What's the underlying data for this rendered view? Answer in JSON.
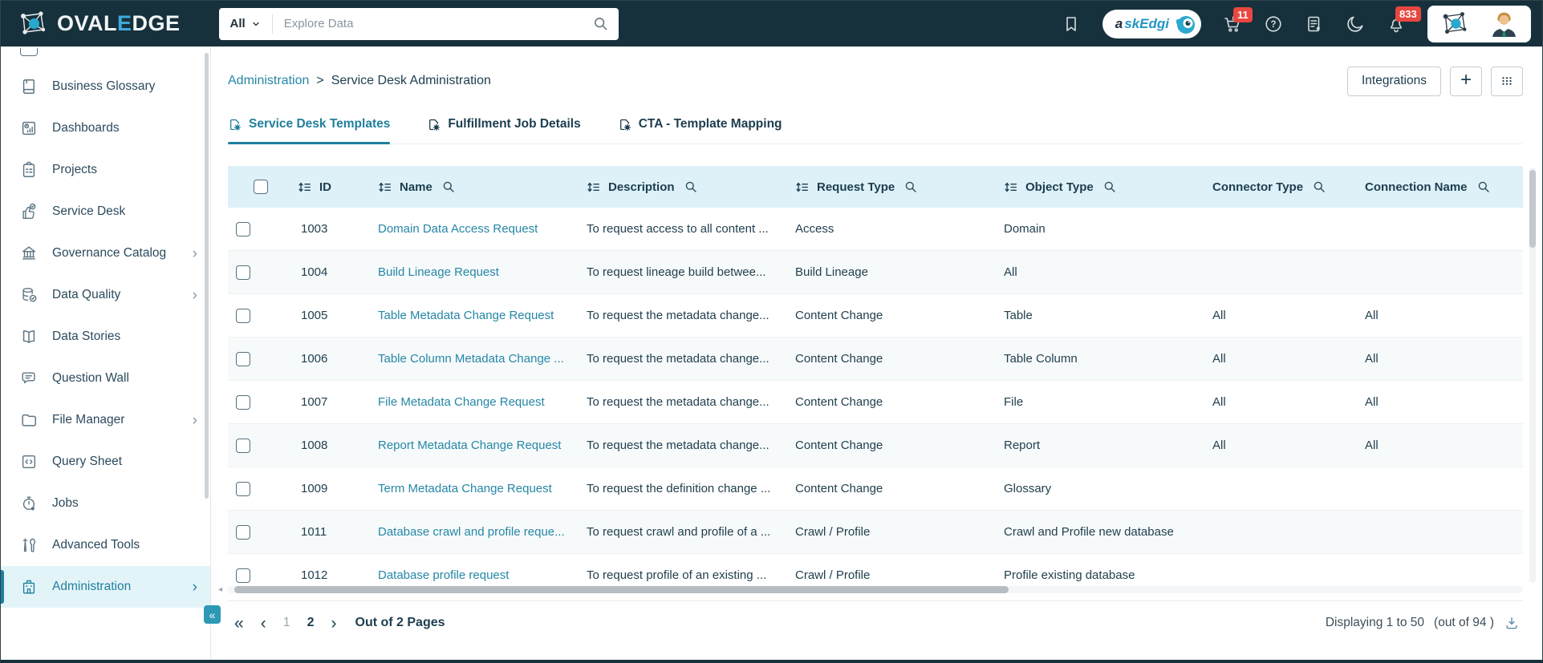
{
  "colors": {
    "accent": "#1F7F9D",
    "header_bg": "#17313C",
    "badge_red": "#E8473F",
    "table_header_bg": "#DEF1F8",
    "link_teal": "#2587A6",
    "logo_accent": "#3FA9DC"
  },
  "topbar": {
    "brand": {
      "prefix": "OVAL",
      "accent": "E",
      "suffix": "DGE"
    },
    "search": {
      "scope_label": "All",
      "placeholder": "Explore Data"
    },
    "askedgi": {
      "label_prefix": "a",
      "label_rest": "skEdgi"
    },
    "cart_badge": "11",
    "bell_badge": "833"
  },
  "sidebar": {
    "items": [
      {
        "label": "Business Glossary",
        "icon": "#i-book",
        "chevron": false,
        "active": false
      },
      {
        "label": "Dashboards",
        "icon": "#i-dashboard",
        "chevron": false,
        "active": false
      },
      {
        "label": "Projects",
        "icon": "#i-clipboard",
        "chevron": false,
        "active": false
      },
      {
        "label": "Service Desk",
        "icon": "#i-service",
        "chevron": false,
        "active": false
      },
      {
        "label": "Governance Catalog",
        "icon": "#i-bank",
        "chevron": true,
        "active": false
      },
      {
        "label": "Data Quality",
        "icon": "#i-dbcheck",
        "chevron": true,
        "active": false
      },
      {
        "label": "Data Stories",
        "icon": "#i-openbook",
        "chevron": false,
        "active": false
      },
      {
        "label": "Question Wall",
        "icon": "#i-chat",
        "chevron": false,
        "active": false
      },
      {
        "label": "File Manager",
        "icon": "#i-folder",
        "chevron": true,
        "active": false
      },
      {
        "label": "Query Sheet",
        "icon": "#i-code",
        "chevron": false,
        "active": false
      },
      {
        "label": "Jobs",
        "icon": "#i-clock",
        "chevron": false,
        "active": false
      },
      {
        "label": "Advanced Tools",
        "icon": "#i-tools",
        "chevron": false,
        "active": false
      },
      {
        "label": "Administration",
        "icon": "#i-building",
        "chevron": true,
        "active": true
      }
    ]
  },
  "page": {
    "breadcrumb": {
      "parent": "Administration",
      "separator": ">",
      "current": "Service Desk Administration"
    },
    "actions": {
      "integrations_label": "Integrations",
      "add_label": "+"
    }
  },
  "tabs": [
    {
      "label": "Service Desk Templates",
      "active": true
    },
    {
      "label": "Fulfillment Job Details",
      "active": false
    },
    {
      "label": "CTA - Template Mapping",
      "active": false
    }
  ],
  "table": {
    "columns": [
      {
        "label": "ID",
        "sort": true,
        "search": false
      },
      {
        "label": "Name",
        "sort": true,
        "search": true
      },
      {
        "label": "Description",
        "sort": true,
        "search": true
      },
      {
        "label": "Request Type",
        "sort": true,
        "search": true
      },
      {
        "label": "Object Type",
        "sort": true,
        "search": true
      },
      {
        "label": "Connector Type",
        "sort": false,
        "search": true
      },
      {
        "label": "Connection Name",
        "sort": false,
        "search": true
      }
    ],
    "rows": [
      {
        "id": "1003",
        "name": "Domain Data Access Request",
        "description": "To request access to all content ...",
        "request_type": "Access",
        "object_type": "Domain",
        "connector_type": "",
        "connection_name": ""
      },
      {
        "id": "1004",
        "name": "Build Lineage Request",
        "description": "To request lineage build betwee...",
        "request_type": "Build Lineage",
        "object_type": "All",
        "connector_type": "",
        "connection_name": ""
      },
      {
        "id": "1005",
        "name": "Table Metadata Change Request",
        "description": "To request the metadata change...",
        "request_type": "Content Change",
        "object_type": "Table",
        "connector_type": "All",
        "connection_name": "All"
      },
      {
        "id": "1006",
        "name": "Table Column Metadata Change ...",
        "description": "To request the metadata change...",
        "request_type": "Content Change",
        "object_type": "Table Column",
        "connector_type": "All",
        "connection_name": "All"
      },
      {
        "id": "1007",
        "name": "File Metadata Change Request",
        "description": "To request the metadata change...",
        "request_type": "Content Change",
        "object_type": "File",
        "connector_type": "All",
        "connection_name": "All"
      },
      {
        "id": "1008",
        "name": "Report Metadata Change Request",
        "description": "To request the metadata change...",
        "request_type": "Content Change",
        "object_type": "Report",
        "connector_type": "All",
        "connection_name": "All"
      },
      {
        "id": "1009",
        "name": "Term Metadata Change Request",
        "description": "To request the definition change ...",
        "request_type": "Content Change",
        "object_type": "Glossary",
        "connector_type": "",
        "connection_name": ""
      },
      {
        "id": "1011",
        "name": "Database crawl and profile reque...",
        "description": "To request crawl and profile of a ...",
        "request_type": "Crawl / Profile",
        "object_type": "Crawl and Profile new database",
        "connector_type": "",
        "connection_name": ""
      },
      {
        "id": "1012",
        "name": "Database profile request",
        "description": "To request profile of an existing ...",
        "request_type": "Crawl / Profile",
        "object_type": "Profile existing database",
        "connector_type": "",
        "connection_name": ""
      }
    ]
  },
  "pagination": {
    "first": "«",
    "prev": "‹",
    "next": "›",
    "pages": [
      {
        "label": "1",
        "muted": true
      },
      {
        "label": "2",
        "muted": false
      }
    ],
    "out_of": "Out of 2 Pages",
    "display_text": "Displaying 1 to 50",
    "total_text": "(out of 94 )"
  }
}
